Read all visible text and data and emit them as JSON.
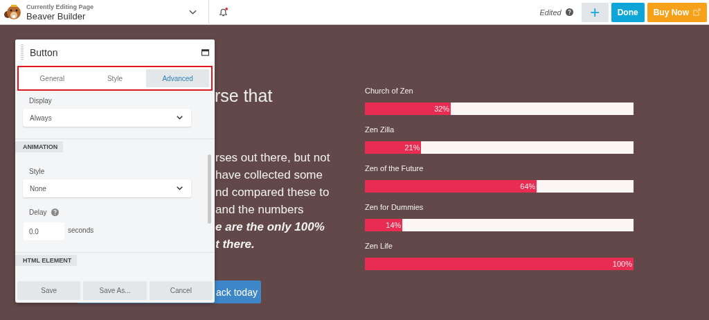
{
  "topbar": {
    "caption": "Currently Editing Page",
    "page": "Beaver Builder",
    "notification": true,
    "status": "Edited",
    "buttons": [
      {
        "kind": "add",
        "label": "+"
      },
      {
        "kind": "done",
        "label": "Done"
      },
      {
        "kind": "buy",
        "label": "Buy Now"
      }
    ]
  },
  "page": {
    "heading": "rse that",
    "paragraph": [
      "rses out there, but not",
      " have collected some",
      "nd compared these to",
      "and the numbers"
    ],
    "emphasis": [
      "e are the only 100%",
      "t there."
    ],
    "button": "ack today"
  },
  "bars": [
    {
      "label": "Church of Zen",
      "level": 0.32,
      "reading": "32%"
    },
    {
      "label": "Zen Zilla",
      "level": 0.21,
      "reading": "21%"
    },
    {
      "label": "Zen of the Future",
      "level": 0.64,
      "reading": "64%"
    },
    {
      "label": "Zen for Dummies",
      "level": 0.14,
      "reading": "14%"
    },
    {
      "label": "Zen Life",
      "level": 1,
      "reading": "100%"
    }
  ],
  "panel": {
    "title": "Button",
    "tabs": [
      {
        "label": "General",
        "selected": false
      },
      {
        "label": "Style",
        "selected": false
      },
      {
        "label": "Advanced",
        "selected": true
      }
    ],
    "display": {
      "label": "Display",
      "value": "Always"
    },
    "sections": [
      {
        "title": "ANIMATION"
      },
      {
        "title": "HTML ELEMENT"
      }
    ],
    "style": {
      "label": "Style",
      "value": "None"
    },
    "delay": {
      "label": "Delay",
      "value": "0.0",
      "unit": "seconds"
    },
    "footer": [
      "Save",
      "Save As...",
      "Cancel"
    ]
  }
}
